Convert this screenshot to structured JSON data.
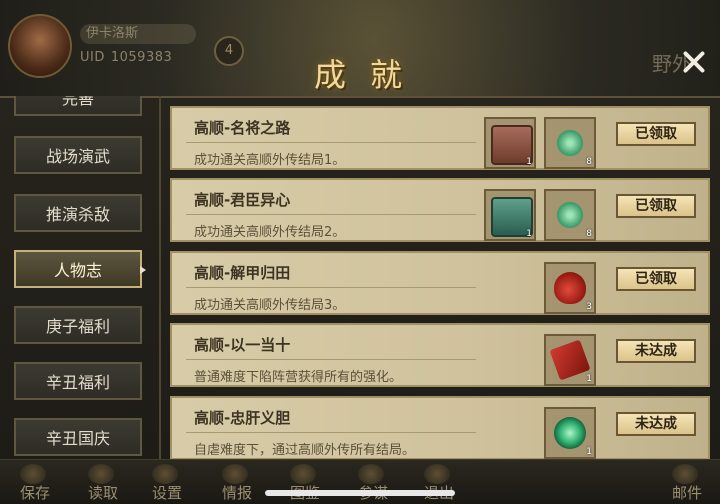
{
  "header": {
    "player_name": "伊卡洛斯",
    "uid_label": "UID",
    "uid_value": "1059383",
    "level": "4",
    "title": "成就",
    "right_label": "野外"
  },
  "sidebar": {
    "items": [
      {
        "label": "完善",
        "active": false
      },
      {
        "label": "战场演武",
        "active": false
      },
      {
        "label": "推演杀敌",
        "active": false
      },
      {
        "label": "人物志",
        "active": true
      },
      {
        "label": "庚子福利",
        "active": false
      },
      {
        "label": "辛丑福利",
        "active": false
      },
      {
        "label": "辛丑国庆",
        "active": false
      }
    ]
  },
  "achievements": [
    {
      "title": "高顺-名将之路",
      "desc": "成功通关高顺外传结局1。",
      "rewards": [
        {
          "icon": "red-chest-icon",
          "qty": "1"
        },
        {
          "icon": "green-gem-icon",
          "qty": "8"
        }
      ],
      "status": "已领取"
    },
    {
      "title": "高顺-君臣异心",
      "desc": "成功通关高顺外传结局2。",
      "rewards": [
        {
          "icon": "green-chest-icon",
          "qty": "1"
        },
        {
          "icon": "green-gem-icon",
          "qty": "8"
        }
      ],
      "status": "已领取"
    },
    {
      "title": "高顺-解甲归田",
      "desc": "成功通关高顺外传结局3。",
      "rewards": [
        {
          "icon": "red-bag-icon",
          "qty": "3"
        }
      ],
      "status": "已领取"
    },
    {
      "title": "高顺-以一当十",
      "desc": "普通难度下陷阵营获得所有的强化。",
      "rewards": [
        {
          "icon": "red-book-icon",
          "qty": "1"
        }
      ],
      "status": "未达成"
    },
    {
      "title": "高顺-忠肝义胆",
      "desc": "自虐难度下，通过高顺外传所有结局。",
      "rewards": [
        {
          "icon": "green-orb-icon",
          "qty": "1"
        }
      ],
      "status": "未达成"
    }
  ],
  "bottom_nav": [
    "保存",
    "读取",
    "设置",
    "情报",
    "图鉴",
    "参谋",
    "退出",
    "邮件"
  ]
}
